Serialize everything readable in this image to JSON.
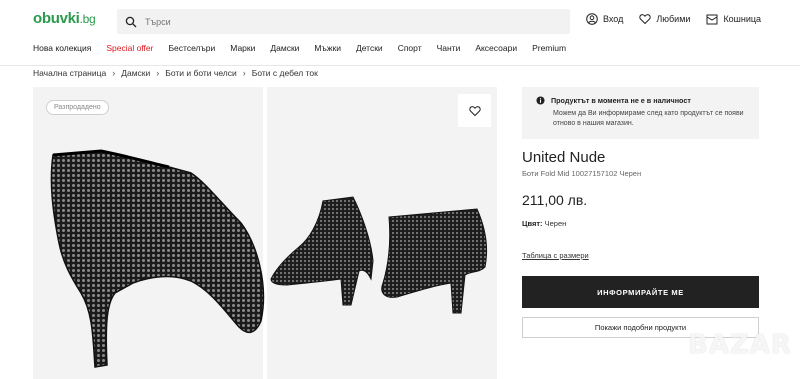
{
  "header": {
    "logo_main": "obuvki",
    "logo_tld": ".bg",
    "search_placeholder": "Търси",
    "login_label": "Вход",
    "favorites_label": "Любими",
    "cart_label": "Кошница"
  },
  "nav": {
    "items": [
      "Нова колекция",
      "Special offer",
      "Бестселъри",
      "Марки",
      "Дамски",
      "Мъжки",
      "Детски",
      "Спорт",
      "Чанти",
      "Аксесоари",
      "Premium"
    ]
  },
  "breadcrumb": [
    "Начална страница",
    "Дамски",
    "Боти и боти челси",
    "Боти с дебел ток"
  ],
  "gallery": {
    "badge": "Разпродадено"
  },
  "product": {
    "notice_title": "Продуктът в момента не е в наличност",
    "notice_text": "Можем да Ви информираме след като продуктът се появи отново в нашия магазин.",
    "brand": "United Nude",
    "subtitle": "Боти Fold Mid 10027157102 Черен",
    "price": "211,00 лв.",
    "color_label": "Цвят:",
    "color_value": "Черен",
    "size_table_link": "Таблица с размери",
    "notify_button": "ИНФОРМИРАЙТЕ МЕ",
    "similar_button": "Покажи подобни продукти"
  },
  "watermark": "BAZAR",
  "colors": {
    "brand_green": "#2a9a4b",
    "special_red": "#e0171f",
    "primary_button": "#222222"
  },
  "icons": [
    "search-icon",
    "user-icon",
    "heart-icon",
    "cart-icon",
    "chevron-right-icon",
    "info-icon"
  ]
}
